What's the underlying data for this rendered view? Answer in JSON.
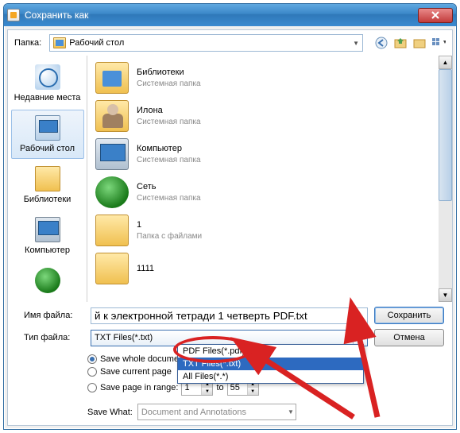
{
  "window": {
    "title": "Сохранить как"
  },
  "toprow": {
    "folder_label": "Папка:",
    "folder_value": "Рабочий стол"
  },
  "sidebar": [
    {
      "label": "Недавние места"
    },
    {
      "label": "Рабочий стол"
    },
    {
      "label": "Библиотеки"
    },
    {
      "label": "Компьютер"
    },
    {
      "label": ""
    }
  ],
  "files": [
    {
      "name": "Библиотеки",
      "sub": "Системная папка"
    },
    {
      "name": "Илона",
      "sub": "Системная папка"
    },
    {
      "name": "Компьютер",
      "sub": "Системная папка"
    },
    {
      "name": "Сеть",
      "sub": "Системная папка"
    },
    {
      "name": "1",
      "sub": "Папка с файлами"
    },
    {
      "name": "1111",
      "sub": ""
    }
  ],
  "form": {
    "filename_label": "Имя файла:",
    "filename_value": "й к электронной тетради 1 четверть PDF.txt",
    "filetype_label": "Тип файла:",
    "filetype_value": "TXT Files(*.txt)",
    "save_btn": "Сохранить",
    "cancel_btn": "Отмена"
  },
  "filetype_options": [
    "PDF Files(*.pdf)",
    "TXT Files(*.txt)",
    "All Files(*.*)"
  ],
  "save_options": {
    "whole": "Save whole document",
    "current": "Save current page",
    "range": "Save page in range:",
    "range_from": "1",
    "range_to_label": "to",
    "range_to": "55"
  },
  "save_what": {
    "label": "Save What:",
    "value": "Document and Annotations"
  }
}
